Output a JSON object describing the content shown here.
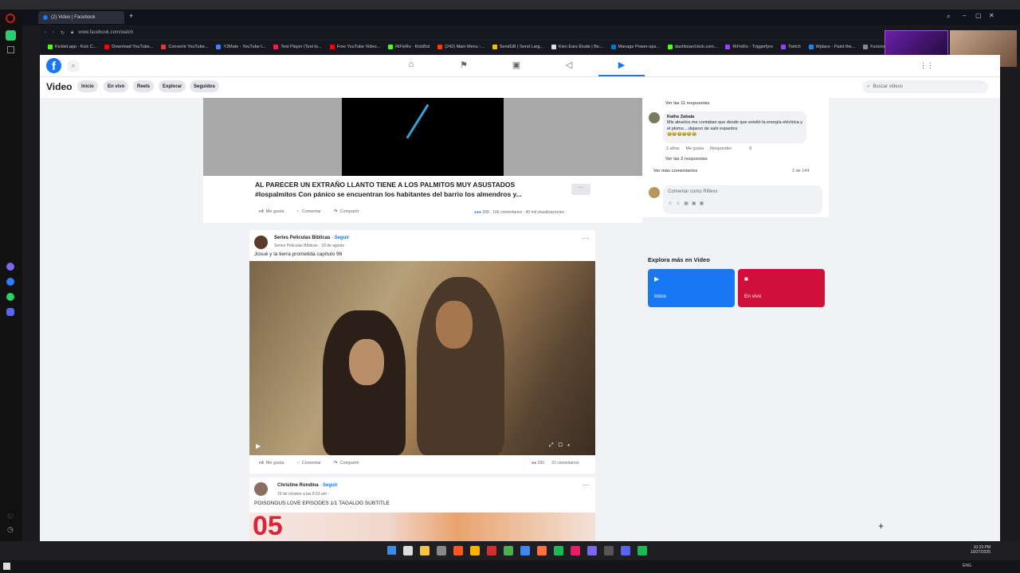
{
  "browser": {
    "tab_title": "(2) Video | Facebook",
    "url": "www.facebook.com/watch",
    "bookmarks": [
      "Kicklet.app - Kick C...",
      "Download YouTube...",
      "Convertir YouTube...",
      "Y2Mate - YouTube t...",
      "Text Player (Text to...",
      "Free YouTube Video...",
      "RiFixRo - KickBot",
      "(242) Main Menu -...",
      "SendGB | Send Larg...",
      "Kien Ears Étude | Be...",
      "Manage Power-ups...",
      "dashboard.kick.com...",
      "RiFixRo - Triggerfyre",
      "Twitch",
      "Wplace - Paint the...",
      "Funcion..."
    ]
  },
  "fb": {
    "logo": "f",
    "section_title": "Video",
    "pills": [
      "Inicio",
      "En vivo",
      "Reels",
      "Explorar",
      "Seguidos"
    ],
    "search_placeholder": "Buscar videos"
  },
  "post1": {
    "title_line1": "AL PARECER UN EXTRAÑO LLANTO TIENE A LOS PALMITOS MUY ASUSTADOS",
    "title_line2": "#lospalmitos Con pánico se encuentran los habitantes del barrio los almendros y...",
    "stats": "268 · 166 comentarios · 40 mil visualizaciones",
    "like": "Me gusta",
    "comment": "Comentar",
    "share": "Compartir",
    "more": "..."
  },
  "comments": {
    "view_replies_11": "Ver las 11 respuestas",
    "author": "Kathe Zabala",
    "text": "Mis abuelos me contaban que desde que existió la energía eléctrica y el plomo....dejaron de salir espantos",
    "emojis": "😂😂😂😂😂😂",
    "time": "2 años",
    "like": "Me gusta",
    "reply": "Responder",
    "reaction_count": "9",
    "view_replies_2": "Ver las 2 respuestas",
    "more_comments": "Ver más comentarios",
    "page_count": "2 de 144",
    "input_placeholder": "Comentar como Rifiexx"
  },
  "explore": {
    "title": "Explora más en Video",
    "inicio": "Inicio",
    "envivo": "En vivo",
    "colors": {
      "inicio": "#1877f2",
      "envivo": "#d0103a"
    }
  },
  "post2": {
    "page": "Series Peliculas Biblicas",
    "follow": "Seguir",
    "sub": "Series Películas Bíblicas · 18 de agosto ·",
    "caption": "Josué y la tierra prometida capítulo 96",
    "reactions": "290",
    "comments": "22 comentarios",
    "like": "Me gusta",
    "comment": "Comentar",
    "share": "Compartir"
  },
  "post3": {
    "page": "Christine Rondina",
    "follow": "Seguir",
    "sub": "19 de octubre a las 6:53 am ·",
    "caption": "POISONOUS LOVE EPISODES 1/1 TAGALOG SUBTITLE",
    "thumb_text": "05"
  },
  "taskbar": {
    "time": "10:23 PM",
    "date": "10/27/2025",
    "lang": "ENG"
  }
}
